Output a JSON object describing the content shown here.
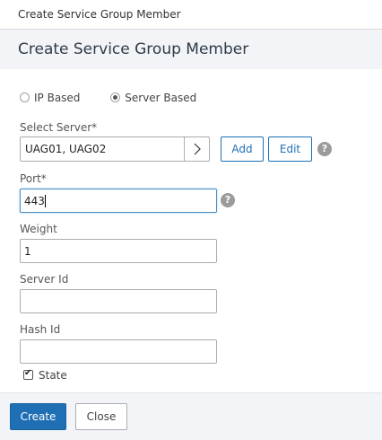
{
  "window": {
    "title": "Create Service Group Member"
  },
  "header": {
    "title": "Create Service Group Member"
  },
  "radios": [
    {
      "label": "IP Based",
      "checked": false
    },
    {
      "label": "Server Based",
      "checked": true
    }
  ],
  "select_server": {
    "label": "Select Server*",
    "value": "UAG01, UAG02",
    "add_label": "Add",
    "edit_label": "Edit"
  },
  "port": {
    "label": "Port*",
    "value": "443"
  },
  "weight": {
    "label": "Weight",
    "value": "1"
  },
  "server_id": {
    "label": "Server Id",
    "value": ""
  },
  "hash_id": {
    "label": "Hash Id",
    "value": ""
  },
  "state": {
    "label": "State",
    "checked": true
  },
  "help_glyph": "?",
  "footer": {
    "create_label": "Create",
    "close_label": "Close"
  },
  "colors": {
    "primary": "#1f6fb5",
    "header_bg": "#f2f4f7",
    "focus_border": "#4a90c8"
  }
}
